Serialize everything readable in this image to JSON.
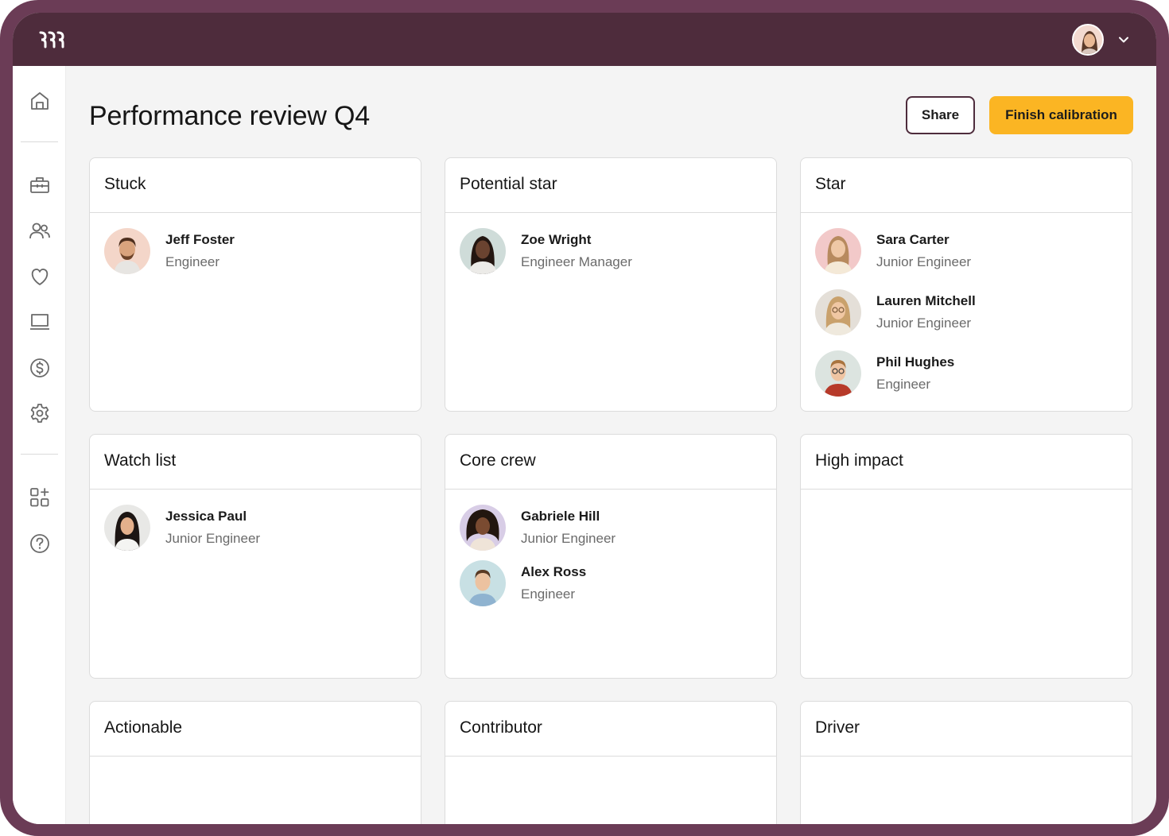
{
  "app": {
    "title": "Performance review Q4"
  },
  "header": {
    "share_label": "Share",
    "finish_label": "Finish calibration"
  },
  "icons": {
    "logo": "brand-logo-icon",
    "user_menu": "chevron-down-icon",
    "sidebar": [
      "home-icon",
      "briefcase-icon",
      "people-icon",
      "heart-icon",
      "laptop-icon",
      "dollar-circle-icon",
      "gear-icon",
      "add-apps-icon",
      "help-icon"
    ]
  },
  "colors": {
    "topbar": "#4e2c3c",
    "accent": "#fbb523",
    "frame": "#6b3c56",
    "canvas": "#f4f4f4"
  },
  "groups": [
    {
      "title": "Stuck",
      "people": [
        {
          "name": "Jeff Foster",
          "role": "Engineer"
        }
      ]
    },
    {
      "title": "Potential star",
      "people": [
        {
          "name": "Zoe Wright",
          "role": "Engineer Manager"
        }
      ]
    },
    {
      "title": "Star",
      "people": [
        {
          "name": "Sara Carter",
          "role": "Junior Engineer"
        },
        {
          "name": "Lauren Mitchell",
          "role": "Junior Engineer"
        },
        {
          "name": "Phil Hughes",
          "role": "Engineer"
        }
      ]
    },
    {
      "title": "Watch list",
      "people": [
        {
          "name": "Jessica Paul",
          "role": "Junior Engineer"
        }
      ]
    },
    {
      "title": "Core crew",
      "people": [
        {
          "name": "Gabriele Hill",
          "role": "Junior Engineer"
        },
        {
          "name": "Alex Ross",
          "role": "Engineer"
        }
      ]
    },
    {
      "title": "High impact",
      "people": []
    },
    {
      "title": "Actionable",
      "people": []
    },
    {
      "title": "Contributor",
      "people": []
    },
    {
      "title": "Driver",
      "people": []
    }
  ]
}
